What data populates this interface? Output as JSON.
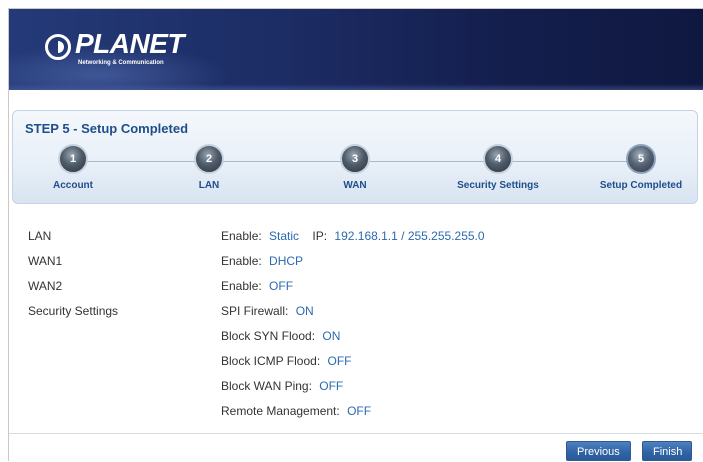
{
  "header": {
    "logo_text": "PLANET",
    "logo_subtext": "Networking & Communication"
  },
  "wizard": {
    "title": "STEP 5 - Setup Completed",
    "steps": [
      {
        "number": "1",
        "label": "Account"
      },
      {
        "number": "2",
        "label": "LAN"
      },
      {
        "number": "3",
        "label": "WAN"
      },
      {
        "number": "4",
        "label": "Security Settings"
      },
      {
        "number": "5",
        "label": "Setup Completed"
      }
    ],
    "current_step": 5
  },
  "summary": {
    "lan": {
      "label": "LAN",
      "enable_label": "Enable:",
      "enable_value": "Static",
      "ip_label": "IP:",
      "ip_value": "192.168.1.1 / 255.255.255.0"
    },
    "wan1": {
      "label": "WAN1",
      "enable_label": "Enable:",
      "enable_value": "DHCP"
    },
    "wan2": {
      "label": "WAN2",
      "enable_label": "Enable:",
      "enable_value": "OFF"
    },
    "security": {
      "label": "Security Settings",
      "items": [
        {
          "label": "SPI Firewall:",
          "value": "ON"
        },
        {
          "label": "Block SYN Flood:",
          "value": "ON"
        },
        {
          "label": "Block ICMP Flood:",
          "value": "OFF"
        },
        {
          "label": "Block WAN Ping:",
          "value": "OFF"
        },
        {
          "label": "Remote Management:",
          "value": "OFF"
        }
      ]
    }
  },
  "buttons": {
    "previous": "Previous",
    "finish": "Finish"
  },
  "colors": {
    "header_bg": "#1c2c64",
    "accent_text": "#1f4e8a",
    "value_text": "#2a6ab0",
    "button_bg": "#2f63a5"
  }
}
